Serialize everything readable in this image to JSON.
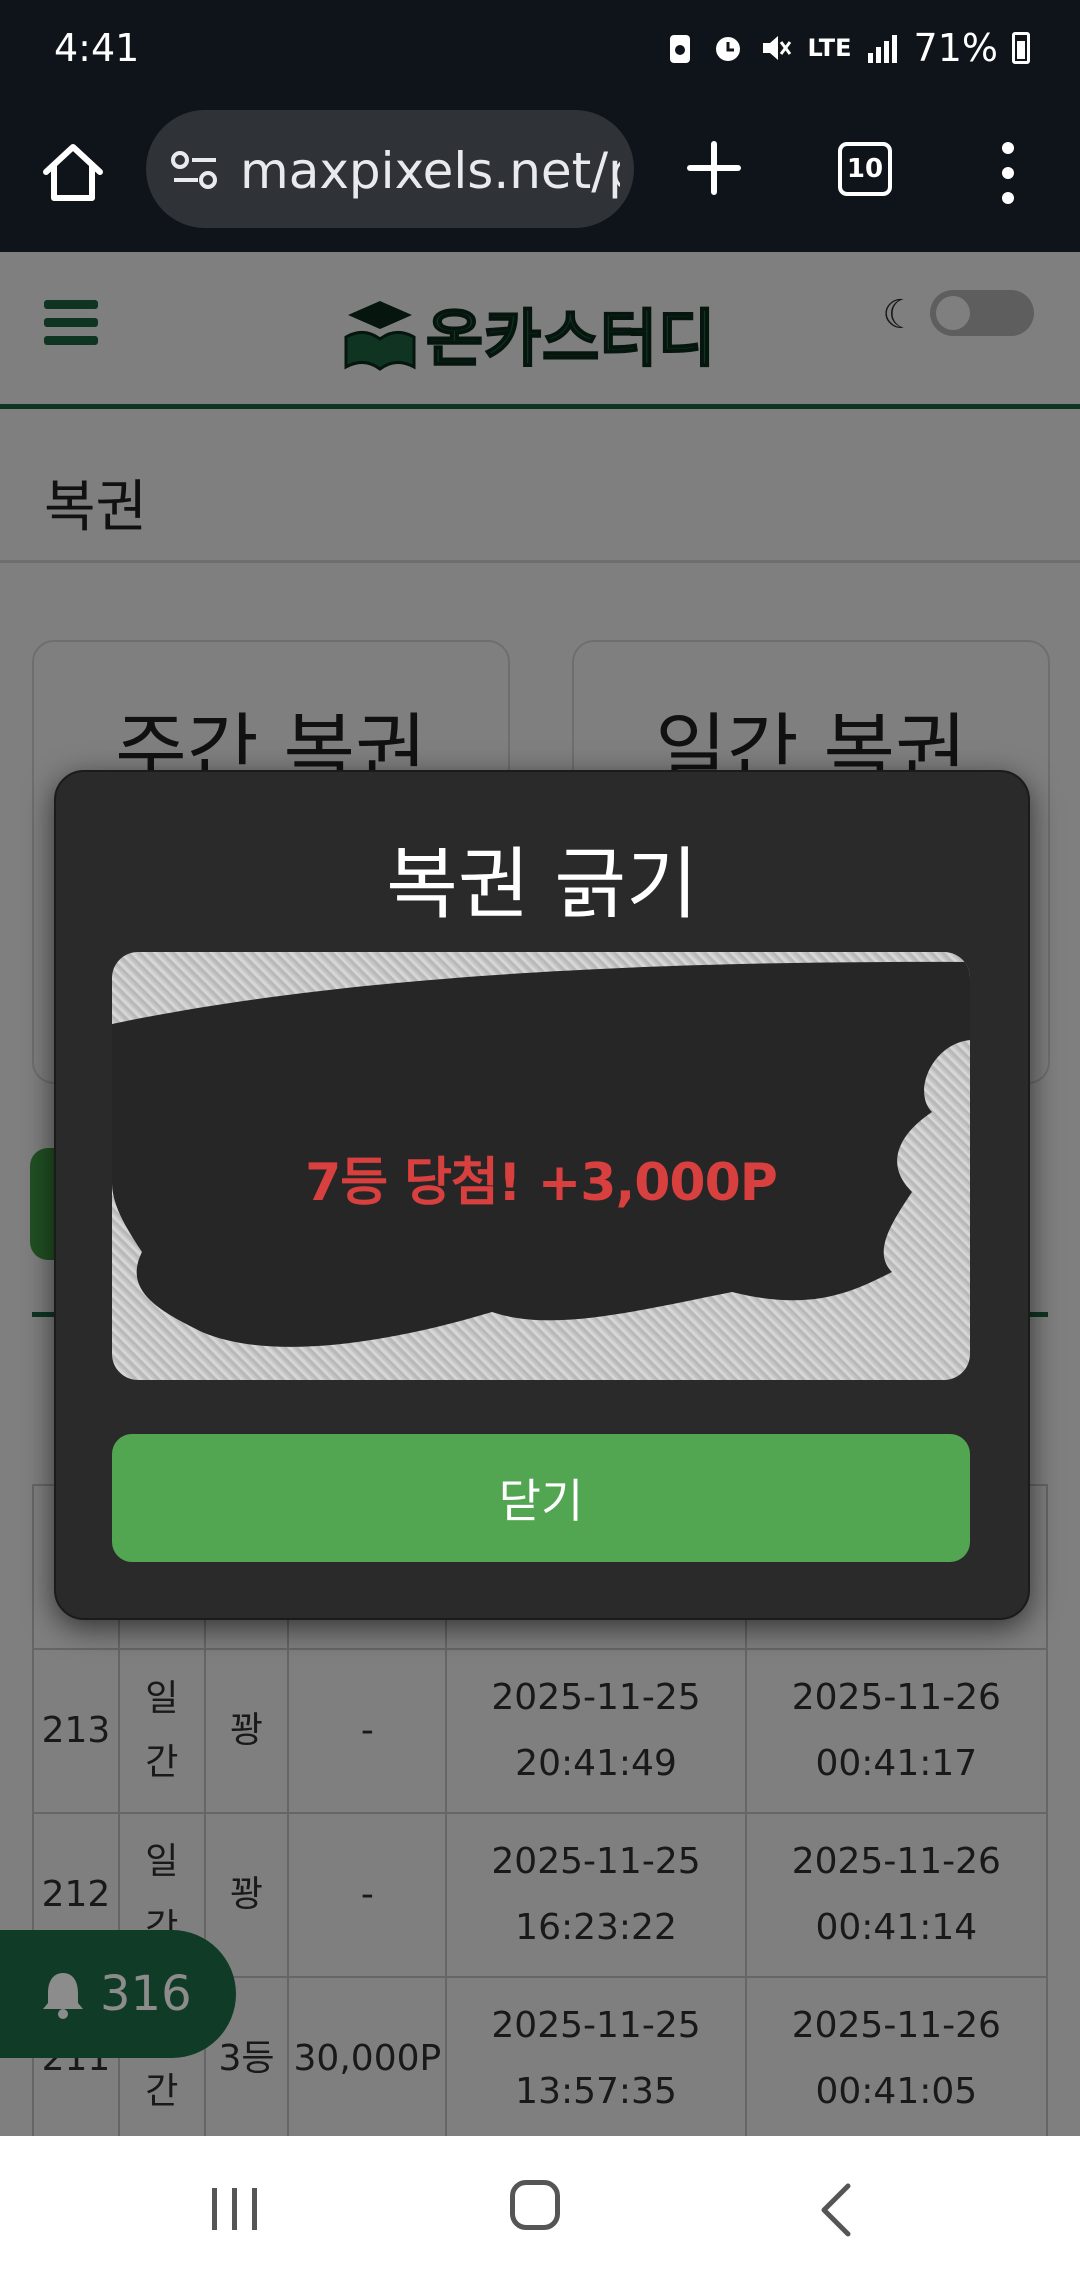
{
  "status_bar": {
    "time": "4:41",
    "network": "LTE",
    "battery": "71%"
  },
  "browser": {
    "url": "maxpixels.net/p",
    "tab_count": "10"
  },
  "site": {
    "logo_text": "온카스터디",
    "section_title": "복권",
    "cards": [
      {
        "title": "주간 복권"
      },
      {
        "title": "일간 복권"
      }
    ],
    "history_rows": [
      {
        "id": "213",
        "type": "일간",
        "result": "꽝",
        "prize": "-",
        "created": "2025-11-25\n20:41:49",
        "scratched": "2025-11-26\n00:41:17"
      },
      {
        "id": "212",
        "type": "일간",
        "result": "꽝",
        "prize": "-",
        "created": "2025-11-25\n16:23:22",
        "scratched": "2025-11-26\n00:41:14"
      },
      {
        "id": "211",
        "type": "일간",
        "result": "3등",
        "prize": "30,000P",
        "created": "2025-11-25\n13:57:35",
        "scratched": "2025-11-26\n00:41:05"
      }
    ],
    "notification_count": "316"
  },
  "modal": {
    "title": "복권 긁기",
    "prize_text": "7등 당첨! +3,000P",
    "close_label": "닫기"
  },
  "colors": {
    "brand_green": "#1e6b45",
    "button_green": "#52a651",
    "prize_red": "#d8403f",
    "modal_bg": "#2a2a2a"
  }
}
